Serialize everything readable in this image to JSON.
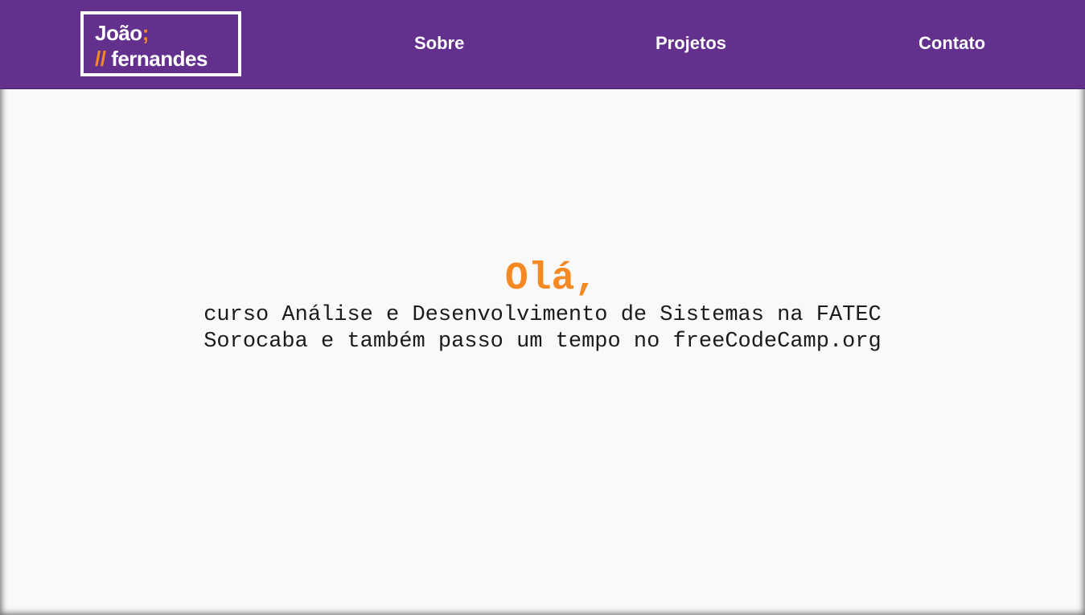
{
  "logo": {
    "line1": "João",
    "line1_accent": ";",
    "line2_accent": "//",
    "line2": "fernandes"
  },
  "nav": {
    "sobre": "Sobre",
    "projetos": "Projetos",
    "contato": "Contato"
  },
  "hero": {
    "title": "Olá,",
    "line1": "curso Análise e Desenvolvimento de Sistemas na FATEC",
    "line2": "Sorocaba e também passo um tempo no freeCodeCamp.org"
  },
  "colors": {
    "navbar": "#63308d",
    "accent": "#f58a24",
    "background": "#f9f9f9"
  }
}
